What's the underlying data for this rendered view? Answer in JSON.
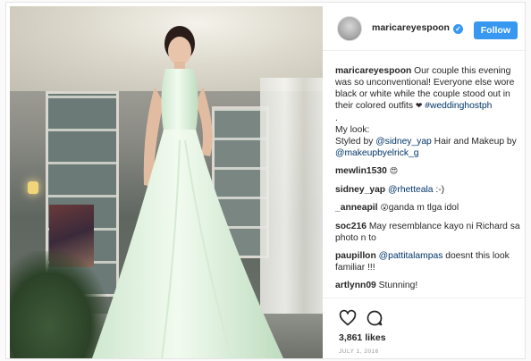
{
  "header": {
    "username": "maricareyespoon",
    "verified_mark": "✓",
    "follow_label": "Follow"
  },
  "caption": {
    "username": "maricareyespoon",
    "text": "Our couple this evening was so unconventional! Everyone else wore black or white while the couple stood out in their colored outfits",
    "heart": "❤",
    "hashtag": "#weddinghostph",
    "dot": ".",
    "look_line": "My look:",
    "styled_by": "Styled by",
    "styled_tag": "@sidney_yap",
    "hair_makeup": "Hair and Makeup by",
    "makeup_tag": "@makeupbyelrick_g"
  },
  "comments": [
    {
      "username": "mewlin1530",
      "text": "😍"
    },
    {
      "username": "sidney_yap",
      "mention": "@rhetteala",
      "text": ":-)"
    },
    {
      "username": "_anneapil",
      "emoji": "😮",
      "text": "ganda m tlga idol"
    },
    {
      "username": "soc216",
      "text": "May resemblance kayo ni Richard sa photo n to"
    },
    {
      "username": "paupillon",
      "mention": "@pattitalampas",
      "text": "doesnt this look familiar !!!"
    },
    {
      "username": "artlynn09",
      "text": "Stunning!"
    }
  ],
  "actions": {
    "like_icon": "heart-outline-icon",
    "comment_icon": "speech-bubble-icon",
    "likes": "3,861 likes",
    "date": "JULY 1, 2016"
  },
  "colors": {
    "accent": "#3897f0",
    "link": "#003569",
    "text": "#262626",
    "muted": "#999999"
  }
}
